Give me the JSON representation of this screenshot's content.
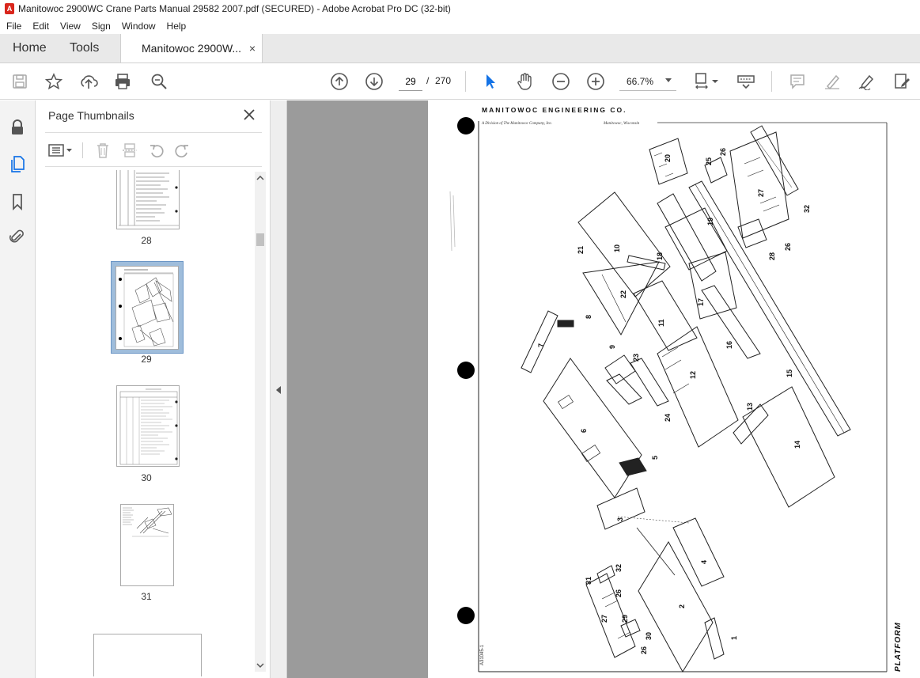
{
  "window": {
    "title": "Manitowoc 2900WC Crane Parts Manual 29582 2007.pdf (SECURED) - Adobe Acrobat Pro DC (32-bit)",
    "app_icon": "pdf-icon"
  },
  "menu": {
    "items": [
      "File",
      "Edit",
      "View",
      "Sign",
      "Window",
      "Help"
    ]
  },
  "tabs": {
    "home": "Home",
    "tools": "Tools",
    "document": "Manitowoc 2900W...",
    "close_glyph": "×"
  },
  "toolbar": {
    "current_page": "29",
    "page_separator": "/",
    "total_pages": "270",
    "zoom": "66.7%",
    "accent_color": "#1473e6"
  },
  "thumbnails_panel": {
    "title": "Page Thumbnails",
    "close_glyph": "✕",
    "pages": [
      {
        "label": "28"
      },
      {
        "label": "29",
        "selected": true
      },
      {
        "label": "30"
      },
      {
        "label": "31"
      }
    ]
  },
  "document": {
    "header_title": "MANITOWOC ENGINEERING CO.",
    "header_sub_left": "A Division of The Manitowoc Company, Inc.",
    "header_sub_right": "Manitowoc, Wisconsin",
    "page_caption": "PLATFORM",
    "drawing_number": "A31045-1",
    "part_numbers": [
      "1",
      "2",
      "3",
      "4",
      "5",
      "6",
      "7",
      "8",
      "9",
      "10",
      "11",
      "12",
      "13",
      "14",
      "15",
      "16",
      "17",
      "18",
      "19",
      "20",
      "21",
      "22",
      "23",
      "24",
      "25",
      "26",
      "27",
      "28",
      "29",
      "30",
      "31",
      "32"
    ]
  }
}
